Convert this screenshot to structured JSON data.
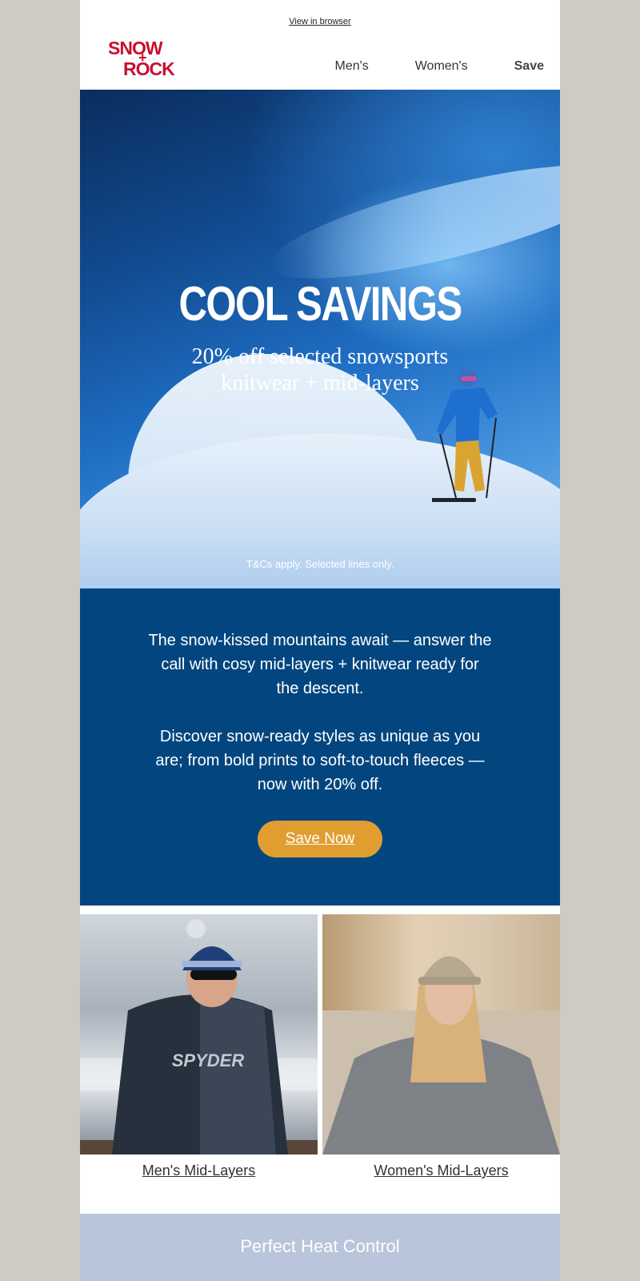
{
  "header": {
    "view_in_browser": "View in browser",
    "logo_line1": "SNOW",
    "logo_plus": "+",
    "logo_line2": "ROCK",
    "nav": [
      "Men's",
      "Women's",
      "Save"
    ]
  },
  "hero": {
    "title": "COOL SAVINGS",
    "subtitle_line1": "20% off selected snowsports",
    "subtitle_line2": "knitwear + mid-layers",
    "terms": "T&Cs apply. Selected lines only."
  },
  "intro": {
    "paragraph1": "The snow-kissed mountains await — answer the call with cosy mid-layers + knitwear ready for the descent.",
    "paragraph2": "Discover snow-ready styles as unique as you are; from bold prints to soft-to-touch fleeces — now with 20% off.",
    "cta_label": "Save Now"
  },
  "products": [
    {
      "label": "Men's Mid-Layers",
      "jacket_print": "SPYDER"
    },
    {
      "label": "Women's Mid-Layers"
    }
  ],
  "footer_band": {
    "title": "Perfect Heat Control"
  },
  "colors": {
    "brand_red": "#c8102e",
    "block_blue": "#03467f",
    "cta_orange": "#e09e30",
    "band_blue": "#b8c5da"
  }
}
